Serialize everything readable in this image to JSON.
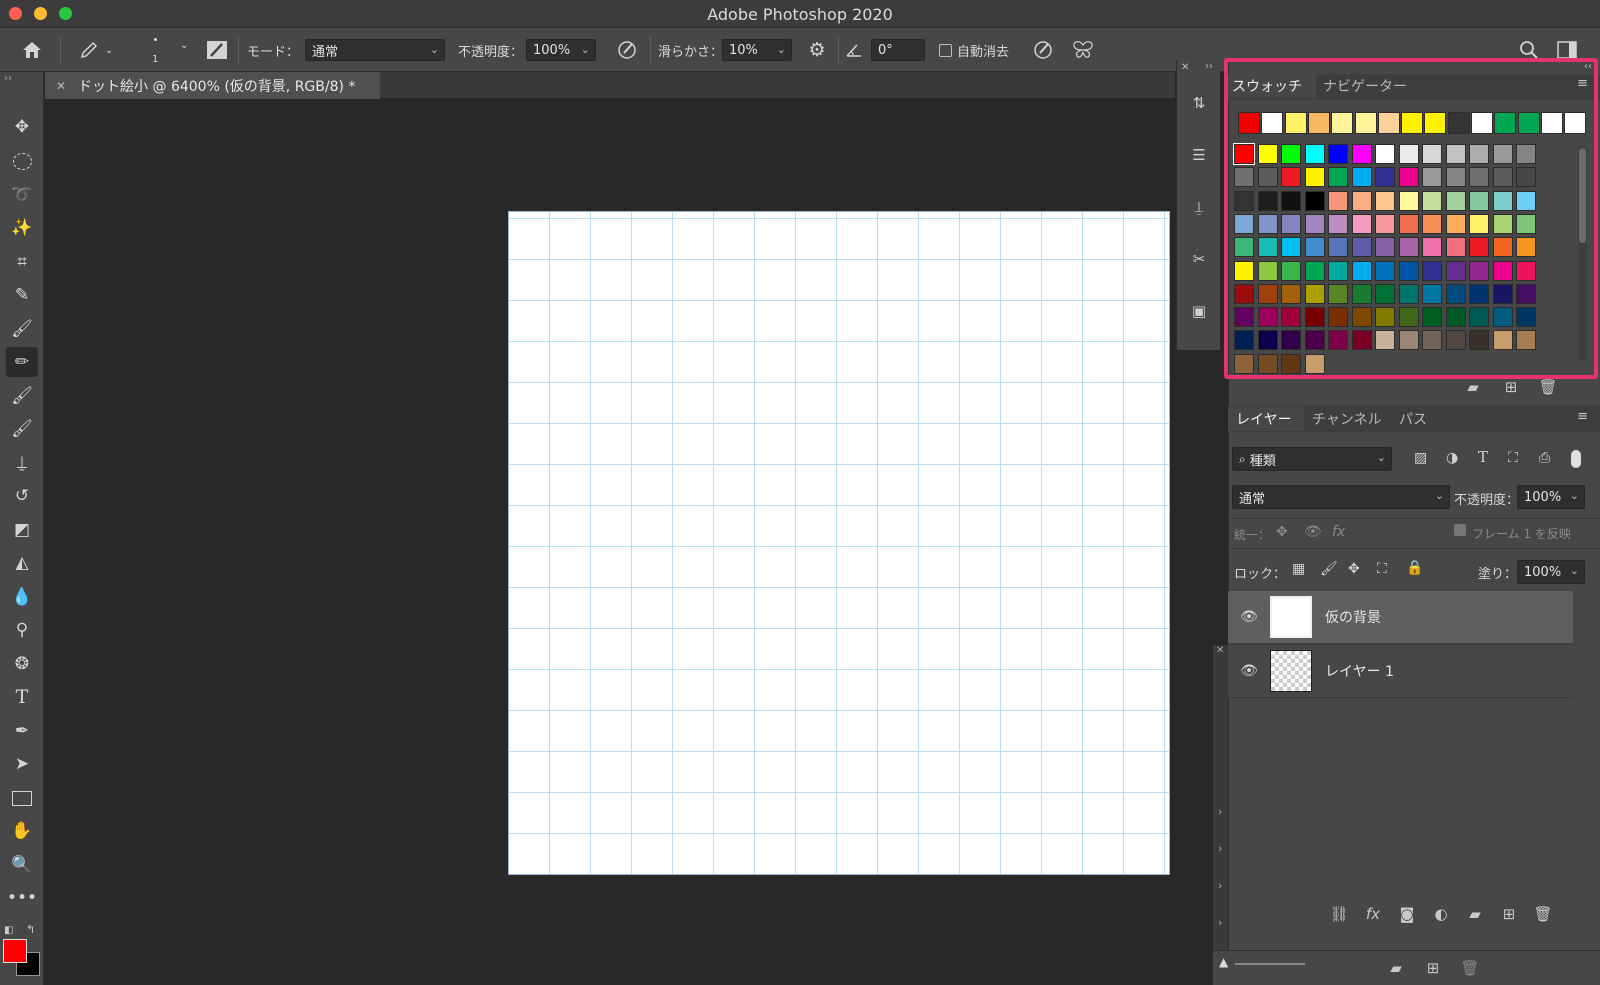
{
  "window": {
    "title": "Adobe Photoshop 2020"
  },
  "options_bar": {
    "brush_size": "1",
    "mode_label": "モード：",
    "mode_value": "通常",
    "opacity_label": "不透明度：",
    "opacity_value": "100%",
    "smoothing_label": "滑らかさ：",
    "smoothing_value": "10%",
    "angle_value": "0°",
    "auto_erase_label": "自動消去"
  },
  "document": {
    "tab_title": "ドット絵小 @ 6400% (仮の背景, RGB/8) *"
  },
  "swatches_panel": {
    "tabs": [
      "スウォッチ",
      "ナビゲーター"
    ],
    "recent_colors": [
      "#f00000",
      "#ffffff",
      "#fff266",
      "#f7b860",
      "#fff499",
      "#fff499",
      "#fdd298",
      "#fff200",
      "#fff200",
      "#343434",
      "#ffffff",
      "#00a651",
      "#00a651",
      "#ffffff",
      "#ffffff"
    ],
    "grid_colors": [
      "#ff0000",
      "#ffff00",
      "#00ff00",
      "#00ffff",
      "#0000ff",
      "#ff00ff",
      "#ffffff",
      "#ebebeb",
      "#d7d7d7",
      "#c2c2c2",
      "#adadad",
      "#999999",
      "#858585",
      "#707070",
      "#5c5c5c",
      "#ed1c24",
      "#fff200",
      "#00a651",
      "#00aeef",
      "#2e3192",
      "#ec008c",
      "#999999",
      "#858585",
      "#707070",
      "#5c5c5c",
      "#474747",
      "#333333",
      "#1f1f1f",
      "#111111",
      "#000000",
      "#f7977a",
      "#f9ad81",
      "#fdc68a",
      "#fff79a",
      "#c4df9b",
      "#a3d39c",
      "#82ca9d",
      "#7bcdc8",
      "#6ecff6",
      "#7ea7d8",
      "#8493ca",
      "#8882be",
      "#a187be",
      "#bc8dbf",
      "#f49ac2",
      "#f6989d",
      "#f26c4f",
      "#f68e55",
      "#fbaf5c",
      "#fff467",
      "#acd372",
      "#7cc576",
      "#3bb878",
      "#1abbb4",
      "#00bff3",
      "#438ccb",
      "#5574b9",
      "#605ca8",
      "#855fa8",
      "#a763a8",
      "#f06ea9",
      "#f26d7d",
      "#ed1c24",
      "#f26522",
      "#f7941d",
      "#fff200",
      "#8dc73f",
      "#39b54a",
      "#00a651",
      "#00a99d",
      "#00aeef",
      "#0072bc",
      "#0054a6",
      "#2e3192",
      "#662d91",
      "#92278f",
      "#ec008c",
      "#ed145b",
      "#9e0b0f",
      "#a0410d",
      "#a36209",
      "#aba000",
      "#598527",
      "#197b30",
      "#007236",
      "#00746b",
      "#0076a3",
      "#004b80",
      "#003471",
      "#1b1464",
      "#440e62",
      "#630460",
      "#9e005d",
      "#9e0039",
      "#790000",
      "#7b2e00",
      "#7d4900",
      "#827b00",
      "#406618",
      "#005e20",
      "#005826",
      "#005952",
      "#005b7f",
      "#003663",
      "#002157",
      "#0d004c",
      "#32004b",
      "#4b0049",
      "#7b0046",
      "#7a0026",
      "#c7b299",
      "#998675",
      "#736357",
      "#534741",
      "#37302d",
      "#c69c6d",
      "#a67c52",
      "#8c6239",
      "#754c24",
      "#603913",
      "#c69c6d"
    ]
  },
  "layers_panel": {
    "tabs": [
      "レイヤー",
      "チャンネル",
      "パス"
    ],
    "filter_kind": "種類",
    "blend_mode": "通常",
    "opacity_label": "不透明度：",
    "opacity_value": "100%",
    "unify_label": "統一：",
    "propagate_frame_label": "フレーム 1 を反映",
    "lock_label": "ロック：",
    "fill_label": "塗り：",
    "fill_value": "100%",
    "layers": [
      {
        "name": "仮の背景",
        "selected": true,
        "visible": true
      },
      {
        "name": "レイヤー 1",
        "selected": false,
        "visible": true
      }
    ]
  },
  "colors": {
    "foreground": "#ff0000",
    "background": "#000000",
    "highlight_border": "#e8316f"
  }
}
